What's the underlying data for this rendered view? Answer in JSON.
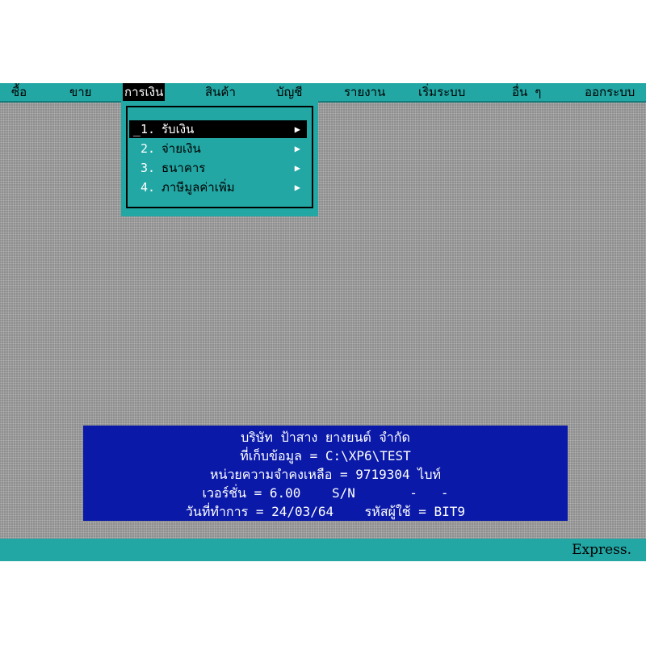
{
  "menubar": {
    "items": [
      {
        "label": "ซื้อ"
      },
      {
        "label": "ขาย"
      },
      {
        "label": "การเงิน",
        "active": true
      },
      {
        "label": "สินค้า"
      },
      {
        "label": "บัญชี"
      },
      {
        "label": "รายงาน"
      },
      {
        "label": "เริ่มระบบ"
      },
      {
        "label": "อื่น ๆ"
      },
      {
        "label": "ออกระบบ"
      }
    ]
  },
  "dropdown": {
    "items": [
      {
        "number": "1.",
        "label": "รับเงิน",
        "arrow": "▶"
      },
      {
        "number": "2.",
        "label": "จ่ายเงิน",
        "arrow": "▶"
      },
      {
        "number": "3.",
        "label": "ธนาคาร",
        "arrow": "▶"
      },
      {
        "number": "4.",
        "label": "ภาษีมูลค่าเพิ่ม",
        "arrow": "▶"
      }
    ],
    "cursor": "_"
  },
  "info": {
    "company": "บริษัท ป้าสาง ยางยนต์ จำกัด",
    "data_path": "ที่เก็บข้อมูล = C:\\XP6\\TEST",
    "memory": "หน่วยความจำคงเหลือ = 9719304 ไบท์",
    "version": "เวอร์ชั่น = 6.00    S/N       -   -",
    "date_user": "วันที่ทำการ = 24/03/64    รหัสผู้ใช้ = BIT9"
  },
  "status": {
    "text": "Express."
  },
  "colors": {
    "teal": "#22a7a4",
    "blue_panel": "#0a19a8"
  }
}
